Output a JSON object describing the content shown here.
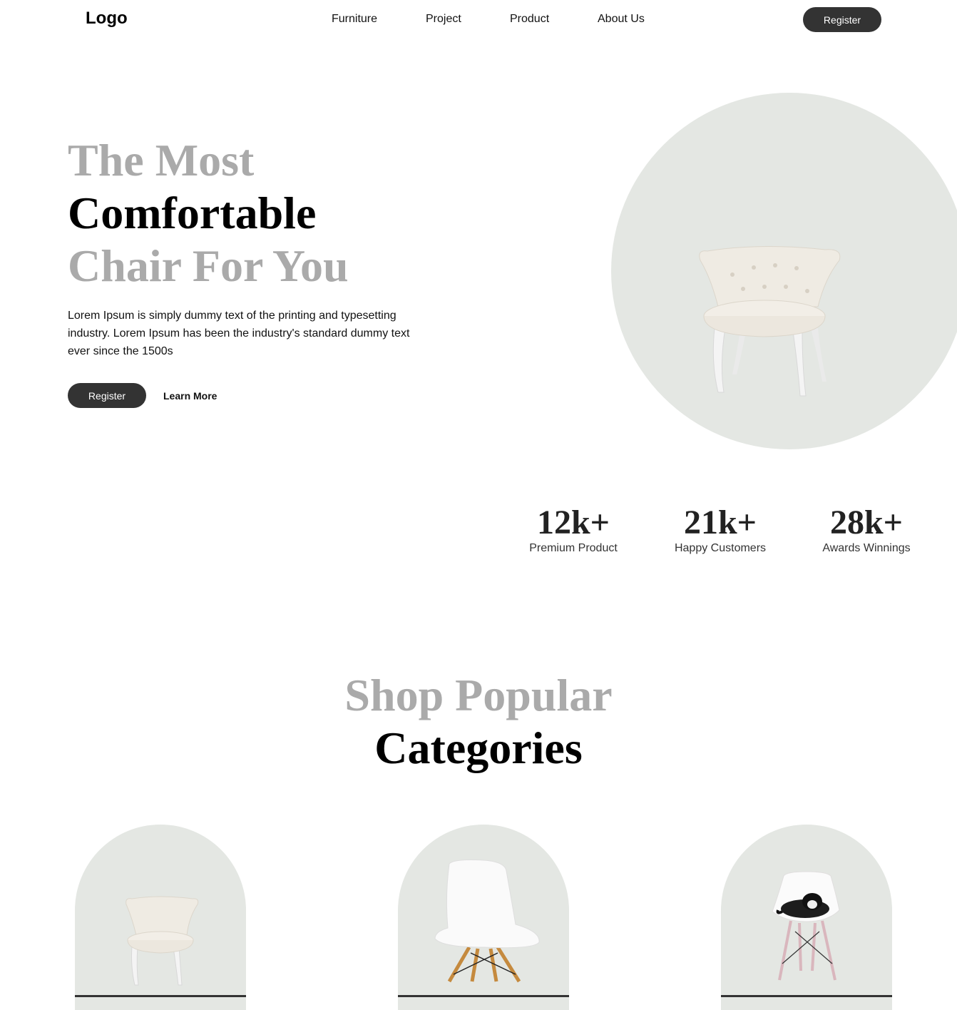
{
  "nav": {
    "logo": "Logo",
    "items": [
      "Furniture",
      "Project",
      "Product",
      "About Us"
    ],
    "register_label": "Register"
  },
  "hero": {
    "line1": "The Most",
    "line2": "Comfortable",
    "line3": "Chair For You",
    "description": "Lorem Ipsum is simply dummy text of the printing and typesetting industry. Lorem Ipsum has been the industry's standard dummy text ever since the 1500s",
    "register_label": "Register",
    "learn_more_label": "Learn More"
  },
  "stats": [
    {
      "value": "12k+",
      "label": "Premium Product"
    },
    {
      "value": "21k+",
      "label": "Happy Customers"
    },
    {
      "value": "28k+",
      "label": "Awards Winnings"
    }
  ],
  "categories": {
    "title_line1": "Shop Popular",
    "title_line2": "Categories",
    "items": [
      {
        "icon": "armchair-icon"
      },
      {
        "icon": "white-chair-icon"
      },
      {
        "icon": "cat-chair-icon"
      }
    ]
  },
  "colors": {
    "accent_dark": "#333333",
    "muted_heading": "#aaaaaa",
    "panel_bg": "#e4e7e3"
  }
}
